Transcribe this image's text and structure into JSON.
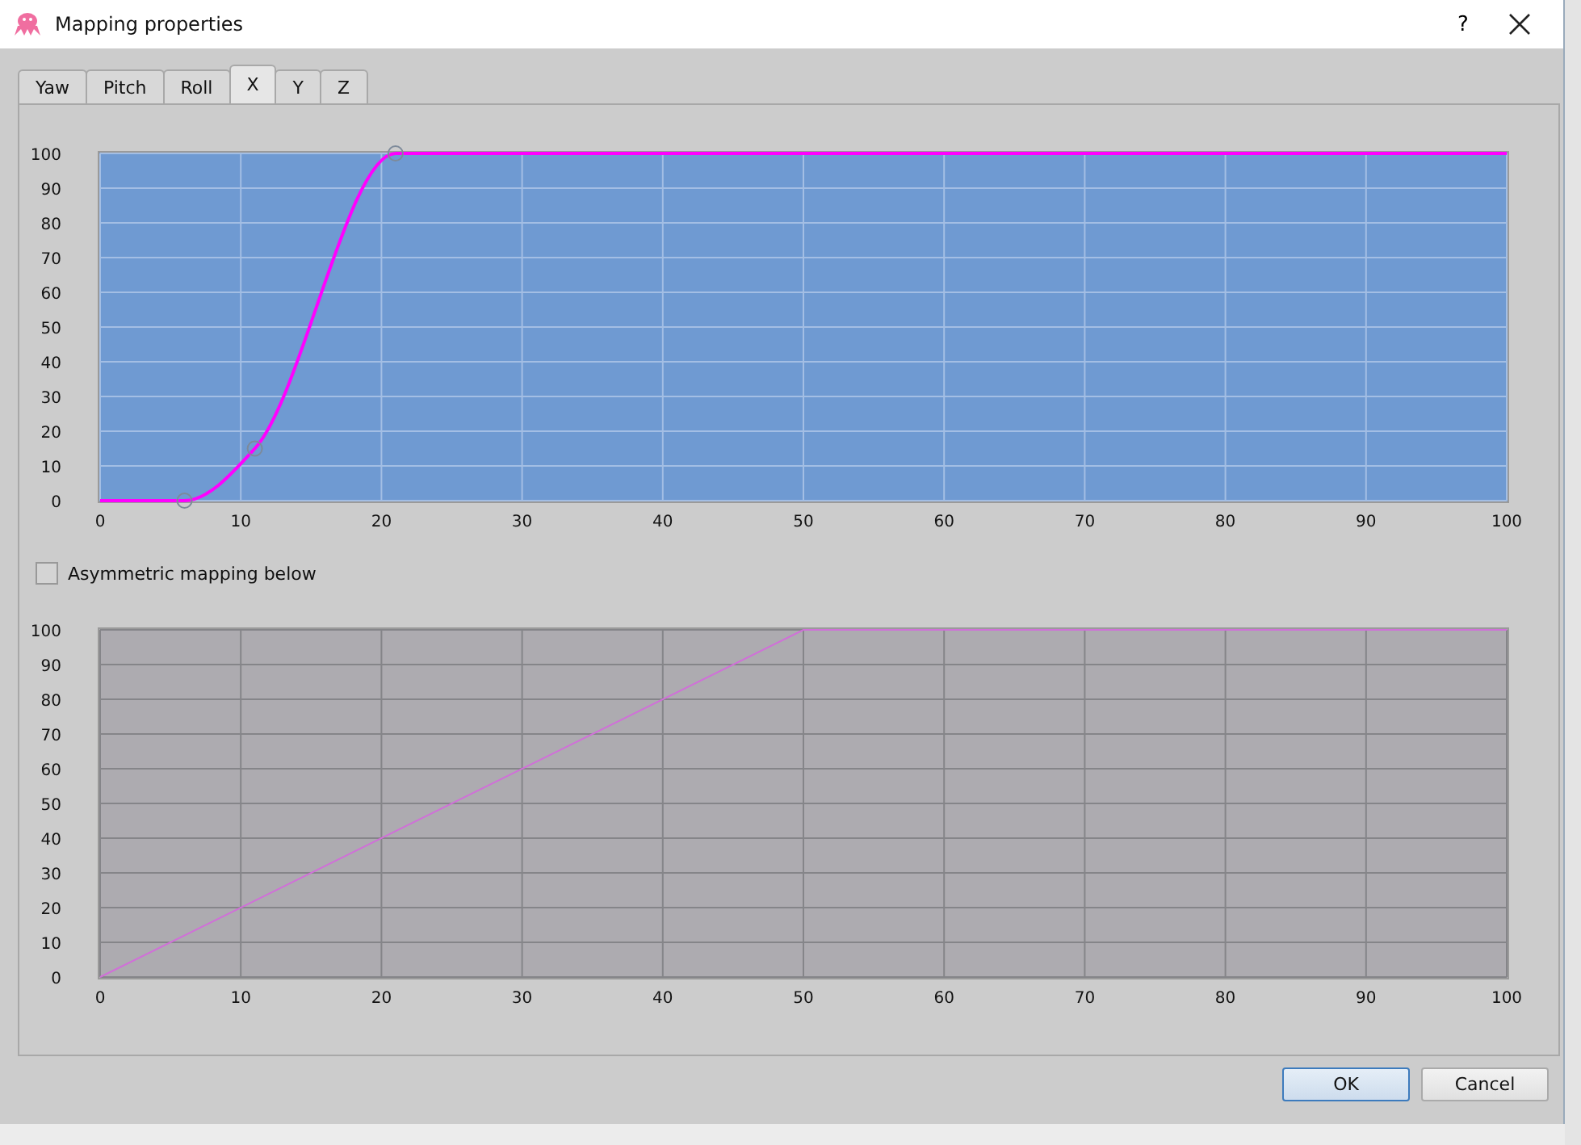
{
  "window": {
    "title": "Mapping properties",
    "help": "?"
  },
  "tabs": [
    {
      "label": "Yaw",
      "selected": false
    },
    {
      "label": "Pitch",
      "selected": false
    },
    {
      "label": "Roll",
      "selected": false
    },
    {
      "label": "X",
      "selected": true
    },
    {
      "label": "Y",
      "selected": false
    },
    {
      "label": "Z",
      "selected": false
    }
  ],
  "upper_chart": {
    "chart_data": {
      "type": "line",
      "x": [
        0,
        6,
        11,
        21,
        100
      ],
      "series": [
        {
          "color": "#ff00ff",
          "values": [
            0,
            0,
            15,
            100,
            100
          ]
        }
      ],
      "grid": true,
      "xlim": [
        0,
        100
      ],
      "ylim": [
        0,
        100
      ],
      "xticks": [
        0,
        10,
        20,
        30,
        40,
        50,
        60,
        70,
        80,
        90,
        100
      ],
      "yticks": [
        0,
        10,
        20,
        30,
        40,
        50,
        60,
        70,
        80,
        90,
        100
      ]
    }
  },
  "asymmetric_checkbox": {
    "label": "Asymmetric mapping below",
    "checked": false
  },
  "lower_chart": {
    "chart_data": {
      "type": "line",
      "x": [
        0,
        50,
        100
      ],
      "series": [
        {
          "color": "#d070d8",
          "values": [
            0,
            100,
            100
          ]
        }
      ],
      "grid": true,
      "xlim": [
        0,
        100
      ],
      "ylim": [
        0,
        100
      ],
      "xticks": [
        0,
        10,
        20,
        30,
        40,
        50,
        60,
        70,
        80,
        90,
        100
      ],
      "yticks": [
        0,
        10,
        20,
        30,
        40,
        50,
        60,
        70,
        80,
        90,
        100
      ]
    }
  },
  "buttons": [
    {
      "label": "OK",
      "default": true
    },
    {
      "label": "Cancel",
      "default": false
    }
  ]
}
